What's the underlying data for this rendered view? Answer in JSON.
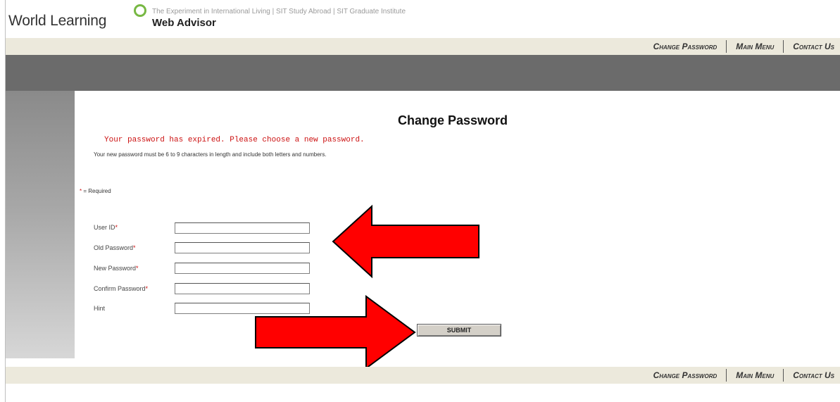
{
  "header": {
    "brand": "World Learning",
    "affiliates": "The Experiment in International Living  |  SIT Study Abroad  |  SIT Graduate Institute",
    "product": "Web Advisor"
  },
  "nav": {
    "change_password": "Change Password",
    "main_menu": "Main Menu",
    "contact_us": "Contact Us"
  },
  "page": {
    "title": "Change Password",
    "expired_message": "Your password has expired.  Please choose a new password.",
    "rules": "Your new password must be 6 to 9 characters in length and include both letters and numbers.",
    "required_star": "*",
    "required_text": " = Required"
  },
  "form": {
    "user_id": {
      "label": "User ID",
      "star": "*",
      "value": ""
    },
    "old_password": {
      "label": "Old Password",
      "star": "*",
      "value": ""
    },
    "new_password": {
      "label": "New Password",
      "star": "*",
      "value": ""
    },
    "confirm_password": {
      "label": "Confirm Password",
      "star": "*",
      "value": ""
    },
    "hint": {
      "label": "Hint",
      "value": ""
    },
    "submit_label": "SUBMIT"
  },
  "colors": {
    "accent_red": "#cc1111",
    "arrow_red": "#ff0000",
    "logo_green": "#77b843",
    "nav_bg": "#ece9dc",
    "band_gray": "#6b6b6b"
  }
}
